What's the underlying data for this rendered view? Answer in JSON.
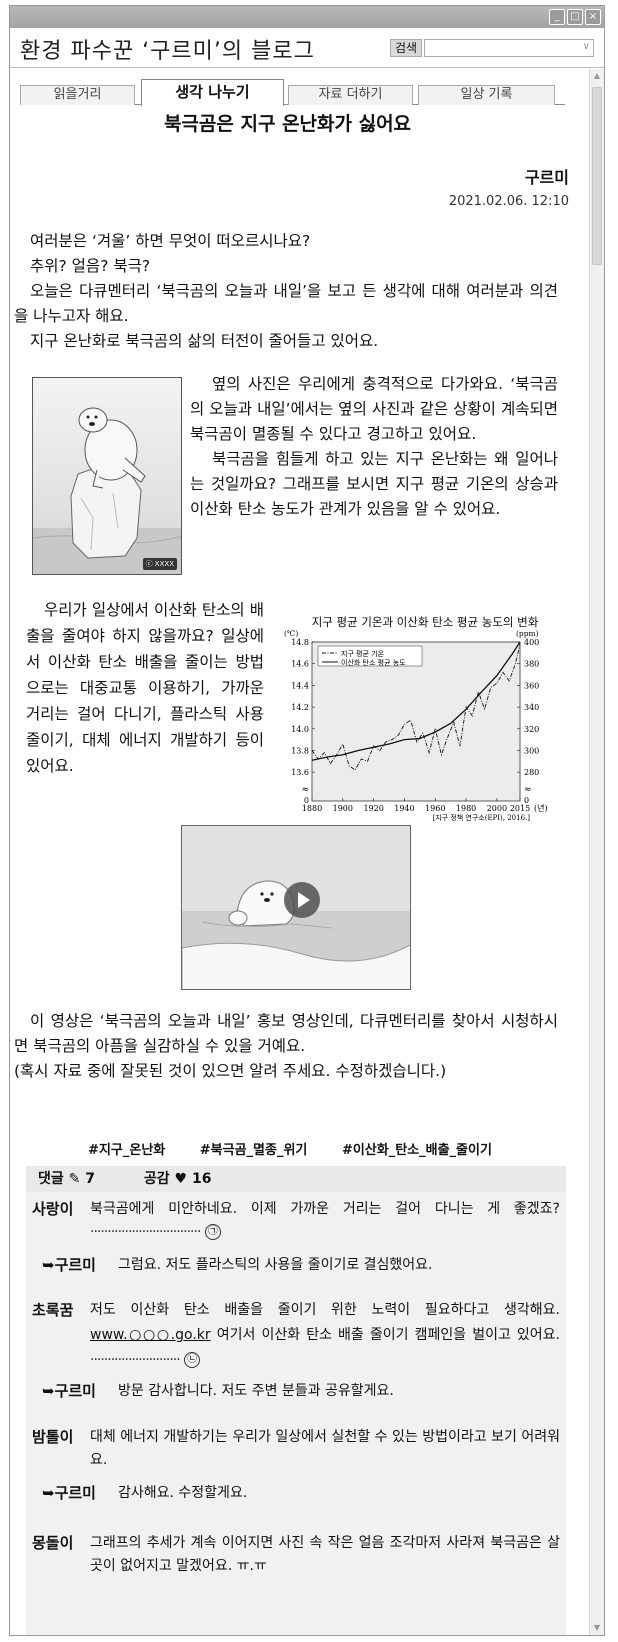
{
  "window": {
    "controls": [
      "_",
      "□",
      "×"
    ]
  },
  "header": {
    "blog_title": "환경 파수꾼 ‘구르미’의 블로그",
    "search_label": "검색",
    "search_value": ""
  },
  "tabs": [
    {
      "label": "읽을거리",
      "active": false
    },
    {
      "label": "생각 나누기",
      "active": true
    },
    {
      "label": "자료 더하기",
      "active": false
    },
    {
      "label": "일상 기록",
      "active": false
    }
  ],
  "post": {
    "title": "북극곰은 지구 온난화가 싫어요",
    "author": "구르미",
    "date": "2021.02.06. 12:10",
    "intro": [
      "여러분은 ‘겨울’ 하면 무엇이 떠오르시나요?",
      "추위? 얼음? 북극?",
      "오늘은 다큐멘터리 ‘북극곰의 오늘과 내일’을 보고 든 생각에 대해 여러분과 의견을 나누고자 해요.",
      "지구 온난화로 북극곰의 삶의 터전이 줄어들고 있어요."
    ],
    "photo_text": [
      "옆의 사진은 우리에게 충격적으로 다가와요. ‘북극곰의 오늘과 내일’에서는 옆의 사진과 같은 상황이 계속되면 북극곰이 멸종될 수 있다고 경고하고 있어요.",
      "북극곰을 힘들게 하고 있는 지구 온난화는 왜 일어나는 것일까요? 그래프를 보시면 지구 평균 기온의 상승과 이산화 탄소 농도가 관계가 있음을 알 수 있어요."
    ],
    "photo_license": "ⓒ XXXX",
    "chart_text": "우리가 일상에서 이산화 탄소의 배출을 줄여야 하지 않을까요? 일상에서 이산화 탄소 배출을 줄이는 방법으로는 대중교통 이용하기, 가까운 거리는 걸어 다니기, 플라스틱 사용 줄이기, 대체 에너지 개발하기 등이 있어요.",
    "video_text": [
      "이 영상은 ‘북극곰의 오늘과 내일’ 홍보 영상인데, 다큐멘터리를 찾아서 시청하시면 북극곰의 아픔을 실감하실 수 있을 거예요.",
      "(혹시 자료 중에 잘못된 것이 있으면 알려 주세요. 수정하겠습니다.)"
    ],
    "hashtags": [
      "#지구_온난화",
      "#북극곰_멸종_위기",
      "#이산화_탄소_배출_줄이기"
    ]
  },
  "chart_data": {
    "type": "line",
    "title": "지구 평균 기온과 이산화 탄소 평균 농도의 변화",
    "y_left_unit": "(℃)",
    "y_right_unit": "(ppm)",
    "x_unit": "(년)",
    "source": "[지구 정책 연구소(EPI), 2016.]",
    "x_ticks": [
      "1880",
      "1900",
      "1920",
      "1940",
      "1960",
      "1980",
      "2000",
      "2015"
    ],
    "y_left_ticks": [
      "13.6",
      "13.8",
      "14.0",
      "14.2",
      "14.4",
      "14.6",
      "14.8"
    ],
    "y_right_ticks": [
      "280",
      "300",
      "320",
      "340",
      "360",
      "380",
      "400"
    ],
    "y_left_zero": "0",
    "y_right_zero": "0",
    "xlim": [
      1880,
      2015
    ],
    "ylim_left": [
      13.5,
      14.8
    ],
    "ylim_right": [
      270,
      400
    ],
    "series": [
      {
        "name": "지구 평균 기온",
        "axis": "left",
        "style": "dash-dot",
        "x": [
          1880,
          1884,
          1888,
          1892,
          1896,
          1900,
          1904,
          1908,
          1912,
          1916,
          1920,
          1924,
          1928,
          1932,
          1936,
          1940,
          1944,
          1948,
          1952,
          1956,
          1960,
          1964,
          1968,
          1972,
          1976,
          1980,
          1984,
          1988,
          1992,
          1996,
          2000,
          2004,
          2008,
          2012,
          2015
        ],
        "values": [
          13.8,
          13.72,
          13.78,
          13.68,
          13.76,
          13.86,
          13.66,
          13.62,
          13.72,
          13.7,
          13.84,
          13.8,
          13.88,
          13.9,
          13.94,
          14.04,
          14.08,
          13.88,
          13.96,
          13.78,
          14.0,
          13.76,
          13.92,
          14.06,
          13.84,
          14.2,
          14.12,
          14.34,
          14.18,
          14.38,
          14.42,
          14.52,
          14.44,
          14.6,
          14.78
        ]
      },
      {
        "name": "이산화 탄소 평균 농도",
        "axis": "right",
        "style": "solid",
        "x": [
          1880,
          1890,
          1900,
          1910,
          1920,
          1930,
          1940,
          1950,
          1960,
          1970,
          1980,
          1990,
          2000,
          2010,
          2015
        ],
        "values": [
          291,
          294,
          296,
          300,
          303,
          306,
          310,
          311,
          317,
          325,
          338,
          354,
          369,
          389,
          400
        ]
      }
    ]
  },
  "comments": {
    "count_label": "댓글",
    "count_icon": "pencil-icon",
    "count": "7",
    "like_label": "공감",
    "like_icon": "heart-icon",
    "likes": "16",
    "items": [
      {
        "nick": "사랑이",
        "text": "북극곰에게 미안하네요. 이제 가까운 거리는 걸어 다니는 게 좋겠죠?",
        "marker": "㉠"
      },
      {
        "nick": "➥구르미",
        "text": "그럼요. 저도 플라스틱의 사용을 줄이기로 결심했어요."
      },
      {
        "nick": "초록꿈",
        "text_before": "저도 이산화 탄소 배출을 줄이기 위한 노력이 필요하다고 생각해요.",
        "link": "www.○○○.go.kr",
        "text_after": "여기서 이산화 탄소 배출 줄이기 캠페인을 벌이고 있어요.",
        "marker": "㉡"
      },
      {
        "nick": "➥구르미",
        "text": "방문 감사합니다. 저도 주변 분들과 공유할게요."
      },
      {
        "nick": "밤톨이",
        "text": "대체 에너지 개발하기는 우리가 일상에서 실천할 수 있는 방법이라고 보기 어려워요."
      },
      {
        "nick": "➥구르미",
        "text": "감사해요. 수정할게요."
      },
      {
        "nick": "몽돌이",
        "text": "그래프의 추세가 계속 이어지면 사진 속 작은 얼음 조각마저 사라져 북극곰은 살 곳이 없어지고 말겠어요. ㅠ.ㅠ"
      }
    ]
  }
}
